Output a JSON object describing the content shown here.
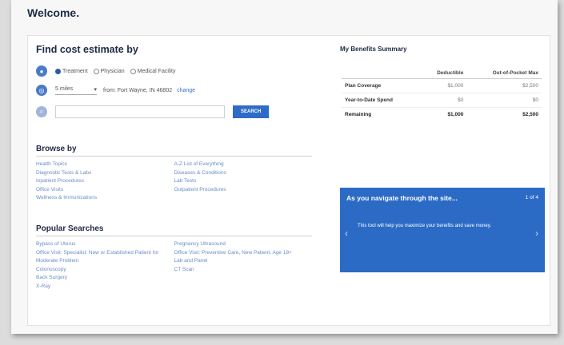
{
  "welcome": "Welcome.",
  "find": {
    "title": "Find cost estimate by",
    "options": [
      "Treatment",
      "Physician",
      "Medical Facility"
    ],
    "distance": "5 miles",
    "location_text": "from: Fort Wayne, IN 46802",
    "change": "change",
    "search_button": "SEARCH"
  },
  "browse": {
    "title": "Browse by",
    "left": [
      "Health Topics",
      "Diagnostic Tests & Labs",
      "Inpatient Procedures",
      "Office Visits",
      "Wellness & Immunizations"
    ],
    "right": [
      "A-Z List of Everything",
      "Diseases & Conditions",
      "Lab Tests",
      "Outpatient Procedures"
    ]
  },
  "popular": {
    "title": "Popular Searches",
    "left": [
      "Bypass of Uterus",
      "Office Visit: Specialist: New or Established Patient for Moderate Problem",
      "Colonoscopy",
      "Back Surgery",
      "X-Ray"
    ],
    "right": [
      "Pregnancy Ultrasound",
      "Office Visit: Preventive Care, New Patient, Age 18+",
      "Lab and Panel",
      "CT Scan"
    ]
  },
  "summary": {
    "title": "My Benefits Summary",
    "col1": "Deductible",
    "col2": "Out-of-Pocket Max",
    "rows": [
      {
        "label": "Plan Coverage",
        "v1": "$1,000",
        "v2": "$2,500"
      },
      {
        "label": "Year-to-Date Spend",
        "v1": "$0",
        "v2": "$0"
      },
      {
        "label": "Remaining",
        "v1": "$1,000",
        "v2": "$2,500"
      }
    ]
  },
  "banner": {
    "title": "As you navigate through the site...",
    "pager": "1 of 4",
    "body": "This tool will help you maximize your benefits and save money."
  }
}
